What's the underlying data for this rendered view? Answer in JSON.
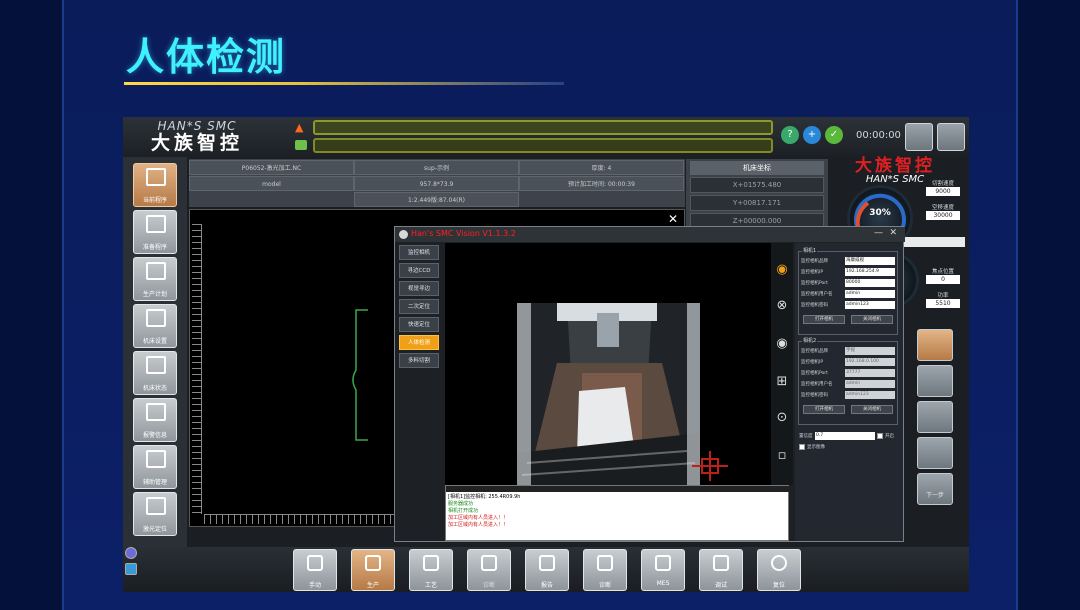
{
  "page_heading": "人体检测",
  "topbar": {
    "logo_en": "HAN*S SMC",
    "logo_cn": "大族智控",
    "clock": "00:00:00"
  },
  "sidebar": {
    "items": [
      {
        "label": "当前程序"
      },
      {
        "label": "准备程序"
      },
      {
        "label": "生产计划"
      },
      {
        "label": "机床设置"
      },
      {
        "label": "机床状态"
      },
      {
        "label": "报警信息"
      },
      {
        "label": "辅助管理"
      },
      {
        "label": "激光定位"
      }
    ]
  },
  "info_table": {
    "r1": [
      "P06052-激光加工.NC",
      "sup-示例",
      "厚度: 4"
    ],
    "r2": [
      "model",
      "957.8*73.9",
      "预计加工时间: 00:00:39"
    ],
    "r3": [
      "1:2.449版:87.04(R)"
    ]
  },
  "right_panel": {
    "header": "机床坐标",
    "rows": [
      "X+01575.480",
      "Y+00817.171",
      "Z+00000.000"
    ],
    "logo_cn": "大族智控",
    "logo_en": "HAN*S SMC",
    "gauge_value": "30%",
    "labels": [
      "切割速度",
      "9000",
      "空移速度",
      "30000",
      "焦点位置",
      "0",
      "功率",
      "5510"
    ],
    "side_buttons": [
      "",
      "",
      "",
      "",
      "下一步"
    ]
  },
  "bottombar": {
    "items": [
      {
        "label": "手动"
      },
      {
        "label": "生产"
      },
      {
        "label": "工艺"
      },
      {
        "label": "诊断"
      },
      {
        "label": "报告"
      },
      {
        "label": "诊断"
      },
      {
        "label": "MES"
      },
      {
        "label": "调试"
      },
      {
        "label": "复位"
      }
    ]
  },
  "modal": {
    "title": "Han's SMC Vision V1.1.3.2",
    "nav": [
      "监控相机",
      "寻边CCD",
      "视觉寻边",
      "二次定位",
      "快速定位",
      "人体检测",
      "多料切割"
    ],
    "active_nav": "人体检测",
    "log_lines": [
      {
        "text": "[相机1]监控相机: 255.4R09.9h",
        "color": "#222222"
      },
      {
        "text": "服务器成功",
        "color": "#1a8a1a"
      },
      {
        "text": "相机打开成功",
        "color": "#1a8a1a"
      },
      {
        "text": "加工区域内有人员进入！！",
        "color": "#d01818"
      },
      {
        "text": "加工区域内有人员进入！！",
        "color": "#d01818"
      }
    ],
    "cam1": {
      "title": "相机1",
      "fields": [
        {
          "label": "监控相机品牌",
          "value": "海康威视"
        },
        {
          "label": "监控相机IP",
          "value": "192.168.254.9"
        },
        {
          "label": "监控相机Port",
          "value": "80000"
        },
        {
          "label": "监控相机用户名",
          "value": "admin"
        },
        {
          "label": "监控相机密码",
          "value": "admin123"
        }
      ],
      "btn_open": "打开相机",
      "btn_close": "关闭相机"
    },
    "cam2": {
      "title": "相机2",
      "fields": [
        {
          "label": "监控相机品牌",
          "value": "宇视"
        },
        {
          "label": "监控相机IP",
          "value": "192.168.0.100"
        },
        {
          "label": "监控相机Port",
          "value": "37777"
        },
        {
          "label": "监控相机用户名",
          "value": "admin"
        },
        {
          "label": "监控相机密码",
          "value": "admin123"
        }
      ],
      "btn_open": "打开相机",
      "btn_close": "关闭相机"
    },
    "threshold_label": "置信度",
    "threshold_value": "0.7",
    "opt_open": "开启",
    "opt_show": "显示图像"
  }
}
